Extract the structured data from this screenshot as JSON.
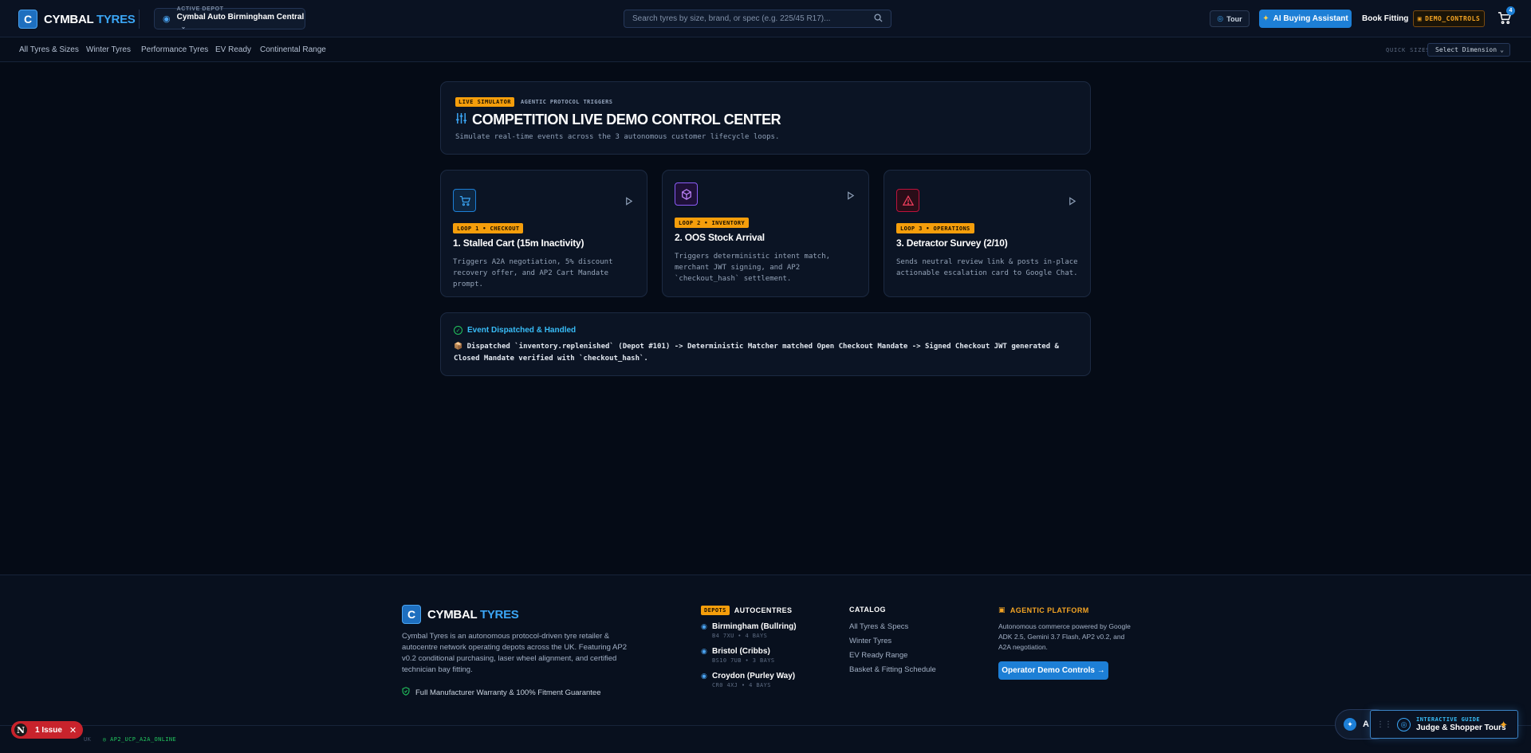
{
  "header": {
    "logo_mark": "C",
    "brand_primary": "CYMBAL",
    "brand_accent": "TYRES",
    "depot_label": "ACTIVE DEPOT",
    "depot_value": "Cymbal Auto Birmingham Central",
    "search_placeholder": "Search tyres by size, brand, or spec (e.g. 225/45 R17)...",
    "tour_label": "Tour",
    "ai_label": "AI Buying Assistant",
    "book_label": "Book Fitting",
    "demo_label": "DEMO_CONTROLS",
    "cart_count": "4"
  },
  "subnav": {
    "items": [
      "All Tyres & Sizes",
      "Winter Tyres",
      "Performance Tyres",
      "EV Ready",
      "Continental Range"
    ],
    "quick_sizes_label": "QUICK SIZES:",
    "quick_sizes_value": "Select Dimension"
  },
  "hero": {
    "pill": "LIVE SIMULATOR",
    "pill_sub": "AGENTIC PROTOCOL TRIGGERS",
    "title": "COMPETITION LIVE DEMO CONTROL CENTER",
    "subtitle": "Simulate real-time events across the 3 autonomous customer lifecycle loops."
  },
  "loops": [
    {
      "pill": "LOOP 1 • CHECKOUT",
      "title": "1. Stalled Cart (15m Inactivity)",
      "desc": "Triggers A2A negotiation, 5% discount recovery offer, and AP2 Cart Mandate prompt."
    },
    {
      "pill": "LOOP 2 • INVENTORY",
      "title": "2. OOS Stock Arrival",
      "desc": "Triggers deterministic intent match, merchant JWT signing, and AP2 `checkout_hash` settlement."
    },
    {
      "pill": "LOOP 3 • OPERATIONS",
      "title": "3. Detractor Survey (2/10)",
      "desc": "Sends neutral review link & posts in-place actionable escalation card to Google Chat."
    }
  ],
  "event": {
    "heading": "Event Dispatched & Handled",
    "body": "📦 Dispatched `inventory.replenished` (Depot #101) -> Deterministic Matcher matched Open Checkout Mandate -> Signed Checkout JWT generated & Closed Mandate verified with `checkout_hash`."
  },
  "footer": {
    "about": "Cymbal Tyres is an autonomous protocol-driven tyre retailer & autocentre network operating depots across the UK. Featuring AP2 v0.2 conditional purchasing, laser wheel alignment, and certified technician bay fitting.",
    "warranty": "Full Manufacturer Warranty & 100% Fitment Guarantee",
    "depots_pill": "DEPOTS",
    "autocentres_h": "AUTOCENTRES",
    "depots": [
      {
        "name": "Birmingham (Bullring)",
        "meta": "B4 7XU • 4 BAYS"
      },
      {
        "name": "Bristol (Cribbs)",
        "meta": "BS10 7UB • 3 BAYS"
      },
      {
        "name": "Croydon (Purley Way)",
        "meta": "CR0 4XJ • 4 BAYS"
      }
    ],
    "catalog_h": "CATALOG",
    "catalog": [
      "All Tyres & Specs",
      "Winter Tyres",
      "EV Ready Range",
      "Basket & Fitting Schedule"
    ],
    "platform_h": "AGENTIC PLATFORM",
    "platform_desc": "Autonomous commerce powered by Google ADK 2.5, Gemini 3.7 Flash, AP2 v0.2, and A2A negotiation.",
    "operator_btn": "Operator Demo Controls →",
    "bottom_uk": "UK",
    "bottom_status": "◎ AP2_UCP_A2A_ONLINE"
  },
  "overlays": {
    "issue_logo": "N",
    "issue_label": "1 Issue",
    "assist_letter": "A",
    "guide_label": "INTERACTIVE GUIDE",
    "guide_value": "Judge & Shopper Tours"
  },
  "colors": {
    "accent": "#1d7fd6",
    "warning": "#f59e0b",
    "success": "#22c55e",
    "danger": "#c8232c"
  }
}
